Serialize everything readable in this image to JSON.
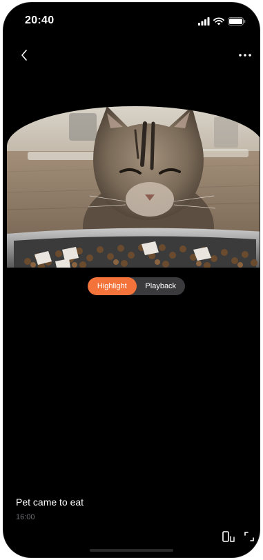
{
  "status_bar": {
    "time": "20:40",
    "icons": [
      "cellular-signal-icon",
      "wifi-icon",
      "battery-icon"
    ]
  },
  "nav": {
    "back_icon": "chevron-left-icon",
    "more_icon": "more-horizontal-icon"
  },
  "video": {
    "content": "cat-eating-from-bowl"
  },
  "mode_toggle": {
    "tabs": [
      {
        "label": "Highlight",
        "active": true
      },
      {
        "label": "Playback",
        "active": false
      }
    ]
  },
  "event": {
    "title": "Pet came to eat",
    "time": "16:00"
  },
  "controls": {
    "portrait_icon": "portrait-mode-icon",
    "fullscreen_icon": "fullscreen-icon"
  },
  "colors": {
    "accent": "#f4733a",
    "background": "#000000",
    "toggle_bg": "#3a3a3c",
    "secondary_text": "#6e6e73"
  }
}
